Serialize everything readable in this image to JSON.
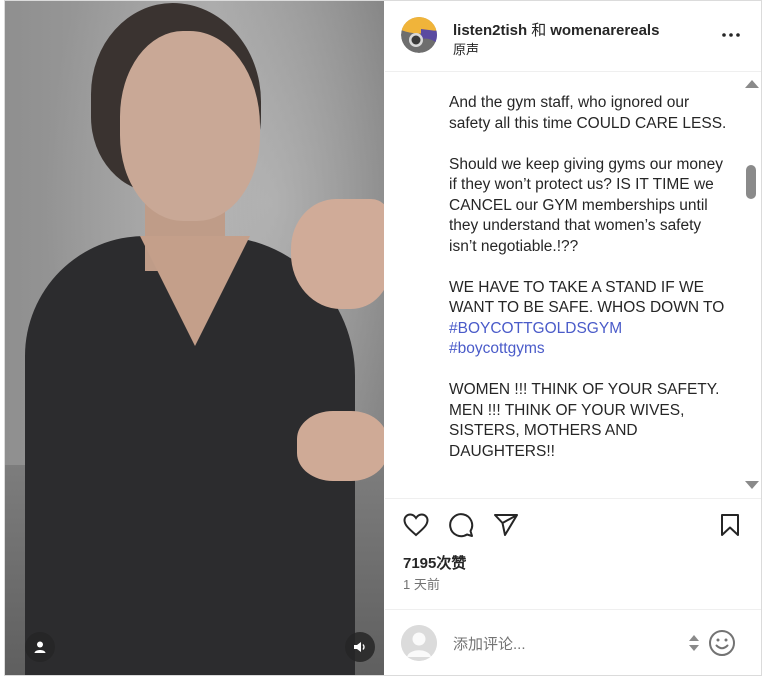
{
  "post": {
    "author_line": {
      "user1": "listen2tish",
      "separator": "和",
      "user2": "womenarereals"
    },
    "audio_label": "原声",
    "caption_paragraphs": [
      {
        "text": "And  the gym staff, who ignored our safety all this time COULD CARE LESS."
      },
      {
        "text": "Should we keep giving gyms our money if they won’t protect us? IS IT TIME we CANCEL  our GYM memberships until they understand that women’s safety isn’t negotiable.!??"
      },
      {
        "text": "WE HAVE TO TAKE A STAND IF WE WANT TO BE SAFE. WHOS DOWN TO ",
        "tags": [
          "#BOYCOTTGOLDSGYM",
          "#boycottgyms"
        ]
      },
      {
        "text": "WOMEN !!! THINK OF YOUR SAFETY. MEN !!! THINK OF YOUR WIVES, SISTERS, MOTHERS AND DAUGHTERS!!"
      }
    ],
    "likes": "7195次赞",
    "time_ago": "1 天前"
  },
  "comment_box": {
    "placeholder": "添加评论..."
  },
  "icons": {
    "more": "more-options-icon",
    "like": "heart-icon",
    "comment": "comment-icon",
    "share": "share-icon",
    "save": "bookmark-icon",
    "emoji": "emoji-icon",
    "user_tag": "user-tag-icon",
    "sound": "sound-icon"
  },
  "colors": {
    "hashtag": "#4a5bc9",
    "text": "#262626",
    "muted": "#737373"
  }
}
